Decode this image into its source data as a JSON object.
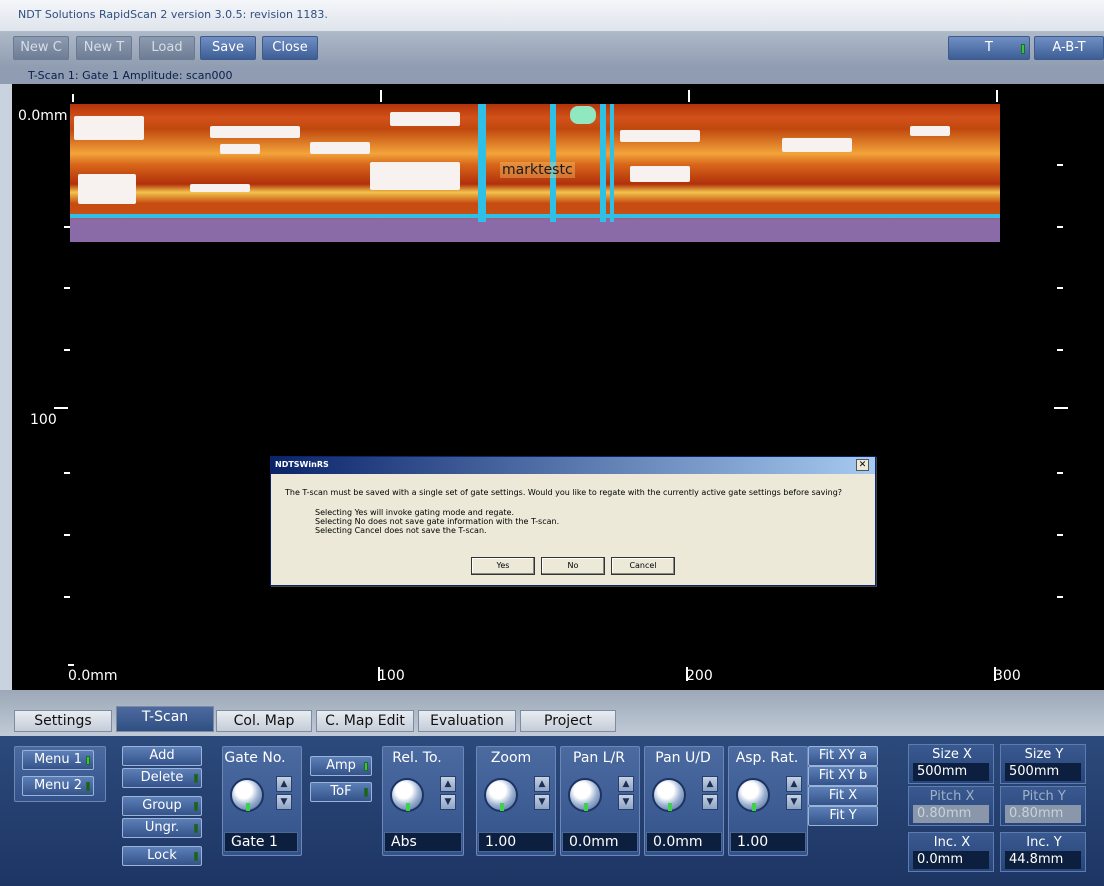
{
  "window": {
    "title": "NDT Solutions RapidScan 2 version 3.0.5: revision 1183."
  },
  "toolbar": {
    "new_c": "New C",
    "new_t": "New T",
    "load": "Load",
    "save": "Save",
    "close": "Close",
    "view_t": "T",
    "view_abt": "A-B-T"
  },
  "scan": {
    "caption": "T-Scan 1: Gate 1 Amplitude: scan000",
    "marker": "marktestc",
    "y_labels": {
      "top": "0.0mm",
      "mid": "100"
    },
    "x_labels": [
      "0.0mm",
      "100",
      "200",
      "300"
    ]
  },
  "dialog": {
    "title": "NDTSWinRS",
    "close": "✕",
    "message": "The T-scan must be saved with a single set of gate settings. Would you like to regate with the currently active gate settings before saving?",
    "lines": [
      "Selecting Yes will invoke gating mode and regate.",
      "Selecting No does not save gate information with the T-scan.",
      "Selecting Cancel does not save the T-scan."
    ],
    "yes": "Yes",
    "no": "No",
    "cancel": "Cancel"
  },
  "tabs": [
    "Settings",
    "T-Scan",
    "Col. Map",
    "C. Map Edit",
    "Evaluation",
    "Project"
  ],
  "active_tab": "T-Scan",
  "panel": {
    "menu1": "Menu 1",
    "menu2": "Menu 2",
    "add": "Add",
    "delete": "Delete",
    "group": "Group",
    "ungroup": "Ungr.",
    "lock": "Lock",
    "gate_no": {
      "label": "Gate No.",
      "value": "Gate 1"
    },
    "amp": "Amp",
    "tof": "ToF",
    "rel_to": {
      "label": "Rel. To.",
      "value": "Abs"
    },
    "zoom": {
      "label": "Zoom",
      "value": "1.00"
    },
    "pan_lr": {
      "label": "Pan L/R",
      "value": "0.0mm"
    },
    "pan_ud": {
      "label": "Pan U/D",
      "value": "0.0mm"
    },
    "asp_rat": {
      "label": "Asp. Rat.",
      "value": "1.00"
    },
    "fit": [
      "Fit XY a",
      "Fit XY b",
      "Fit X",
      "Fit Y"
    ],
    "size_x": {
      "label": "Size X",
      "value": "500mm"
    },
    "size_y": {
      "label": "Size Y",
      "value": "500mm"
    },
    "pitch_x": {
      "label": "Pitch X",
      "value": "0.80mm"
    },
    "pitch_y": {
      "label": "Pitch Y",
      "value": "0.80mm"
    },
    "inc_x": {
      "label": "Inc. X",
      "value": "0.0mm"
    },
    "inc_y": {
      "label": "Inc. Y",
      "value": "44.8mm"
    }
  }
}
